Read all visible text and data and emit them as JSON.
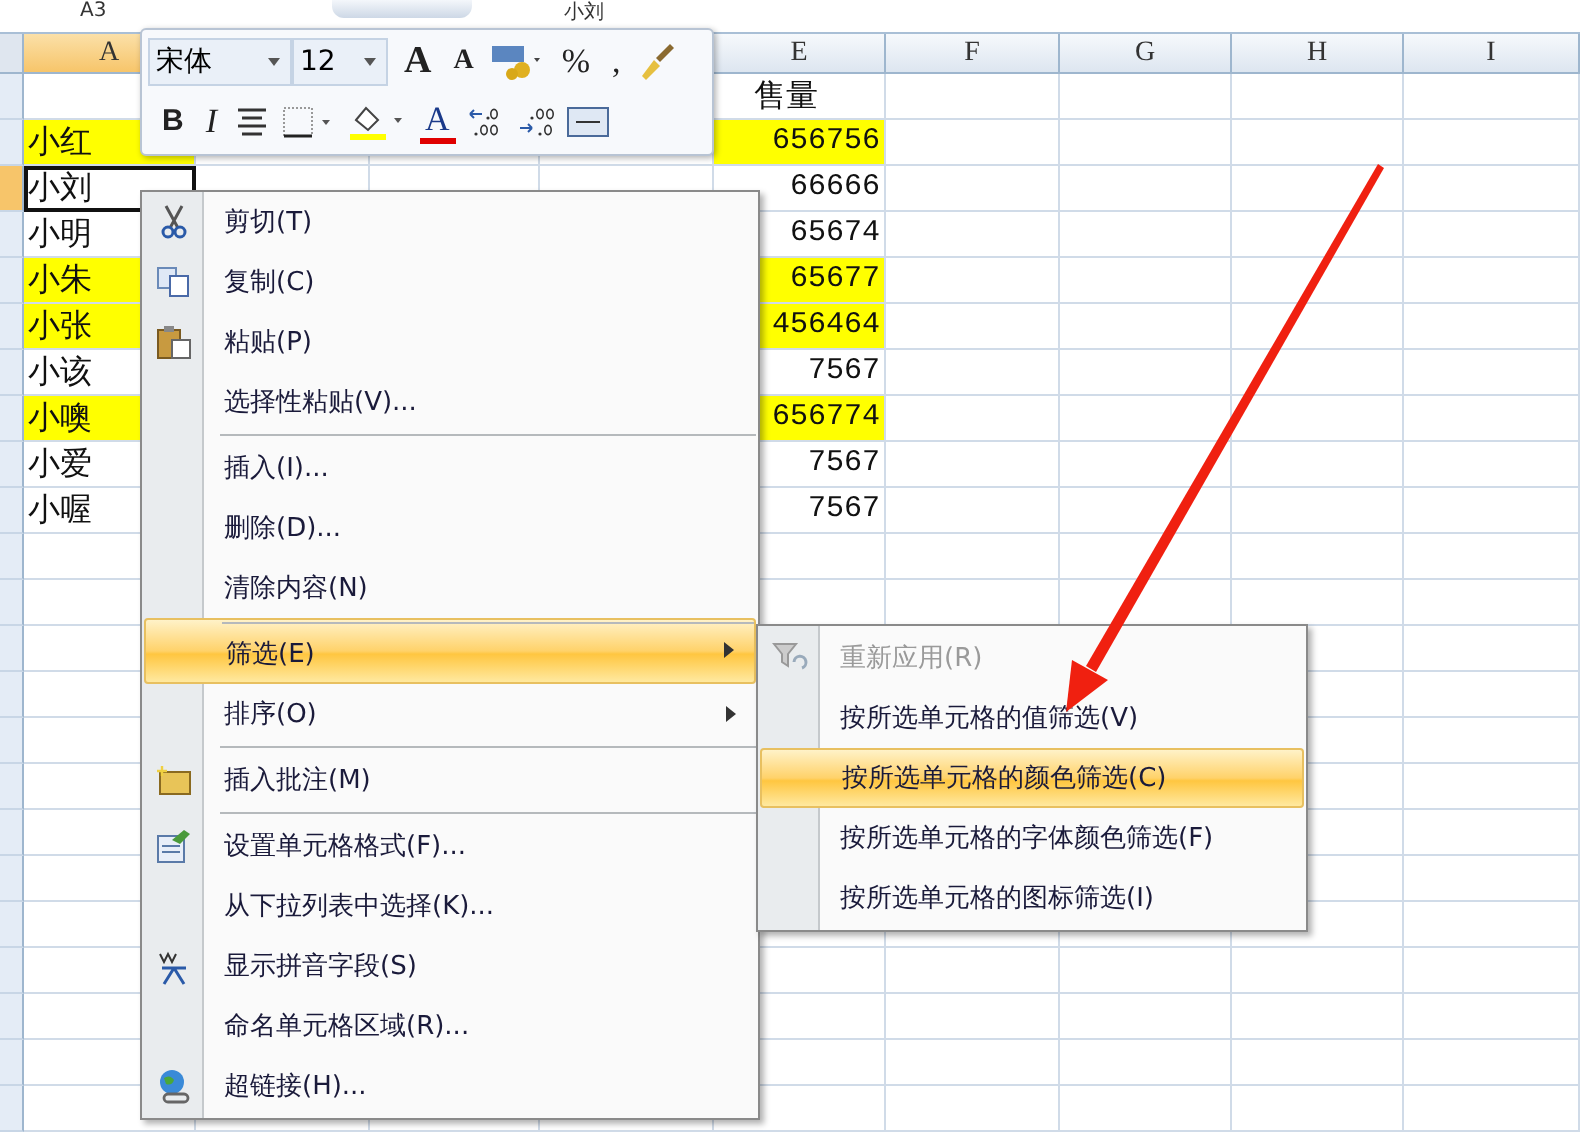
{
  "formula_bar": {
    "name_box": "A3",
    "formula": "小刘"
  },
  "columns_left": [
    "A"
  ],
  "columns_right": [
    "E",
    "F",
    "G",
    "H",
    "I"
  ],
  "rows": [
    {
      "kind": "header",
      "sales": "售量",
      "highlighted": false,
      "selected": false
    },
    {
      "kind": "data",
      "name": "小红",
      "sales": "656756",
      "highlighted": true,
      "selected": false
    },
    {
      "kind": "data",
      "name": "小刘",
      "sales": "66666",
      "highlighted": false,
      "selected": true
    },
    {
      "kind": "data",
      "name": "小明",
      "sales": "65674",
      "highlighted": false,
      "selected": false
    },
    {
      "kind": "data",
      "name": "小朱",
      "sales": "65677",
      "highlighted": true,
      "selected": false
    },
    {
      "kind": "data",
      "name": "小张",
      "sales": "456464",
      "highlighted": true,
      "selected": false
    },
    {
      "kind": "data",
      "name": "小该",
      "sales": "7567",
      "highlighted": false,
      "selected": false
    },
    {
      "kind": "data",
      "name": "小噢",
      "sales": "656774",
      "highlighted": true,
      "selected": false
    },
    {
      "kind": "data",
      "name": "小爱",
      "sales": "7567",
      "highlighted": false,
      "selected": false
    },
    {
      "kind": "data",
      "name": "小喔",
      "sales": "7567",
      "highlighted": false,
      "selected": false
    }
  ],
  "mini_toolbar": {
    "font": "宋体",
    "size": "12",
    "row_1": [
      {
        "kind": "text",
        "label": "A"
      },
      {
        "kind": "text",
        "label": "A"
      },
      {
        "kind": "icon"
      },
      {
        "kind": "text",
        "label": "%"
      },
      {
        "kind": "text",
        "label": ","
      },
      {
        "kind": "icon"
      }
    ],
    "row_2": [
      {
        "kind": "text",
        "label": "B"
      },
      {
        "kind": "text",
        "label": "I"
      },
      {
        "kind": "icon"
      },
      {
        "kind": "icon"
      },
      {
        "kind": "icon"
      },
      {
        "kind": "text",
        "label": "A"
      },
      {
        "kind": "icon"
      },
      {
        "kind": "icon"
      },
      {
        "kind": "icon"
      }
    ]
  },
  "context_menu": [
    {
      "label": "剪切(T)",
      "submenu": false,
      "selected": false,
      "separator_before": false
    },
    {
      "label": "复制(C)",
      "submenu": false,
      "selected": false,
      "separator_before": false
    },
    {
      "label": "粘贴(P)",
      "submenu": false,
      "selected": false,
      "separator_before": false
    },
    {
      "label": "选择性粘贴(V)...",
      "submenu": false,
      "selected": false,
      "separator_before": false
    },
    {
      "label": "插入(I)...",
      "submenu": false,
      "selected": false,
      "separator_before": true
    },
    {
      "label": "删除(D)...",
      "submenu": false,
      "selected": false,
      "separator_before": false
    },
    {
      "label": "清除内容(N)",
      "submenu": false,
      "selected": false,
      "separator_before": false
    },
    {
      "label": "筛选(E)",
      "submenu": true,
      "selected": true,
      "separator_before": true
    },
    {
      "label": "排序(O)",
      "submenu": true,
      "selected": false,
      "separator_before": false
    },
    {
      "label": "插入批注(M)",
      "submenu": false,
      "selected": false,
      "separator_before": true
    },
    {
      "label": "设置单元格格式(F)...",
      "submenu": false,
      "selected": false,
      "separator_before": true
    },
    {
      "label": "从下拉列表中选择(K)...",
      "submenu": false,
      "selected": false,
      "separator_before": false
    },
    {
      "label": "显示拼音字段(S)",
      "submenu": false,
      "selected": false,
      "separator_before": false
    },
    {
      "label": "命名单元格区域(R)...",
      "submenu": false,
      "selected": false,
      "separator_before": false
    },
    {
      "label": "超链接(H)...",
      "submenu": false,
      "selected": false,
      "separator_before": false
    }
  ],
  "filter_submenu": [
    {
      "label": "重新应用(R)",
      "disabled": true,
      "selected": false
    },
    {
      "label": "按所选单元格的值筛选(V)",
      "disabled": false,
      "selected": false
    },
    {
      "label": "按所选单元格的颜色筛选(C)",
      "disabled": false,
      "selected": true
    },
    {
      "label": "按所选单元格的字体颜色筛选(F)",
      "disabled": false,
      "selected": false
    },
    {
      "label": "按所选单元格的图标筛选(I)",
      "disabled": false,
      "selected": false
    }
  ]
}
